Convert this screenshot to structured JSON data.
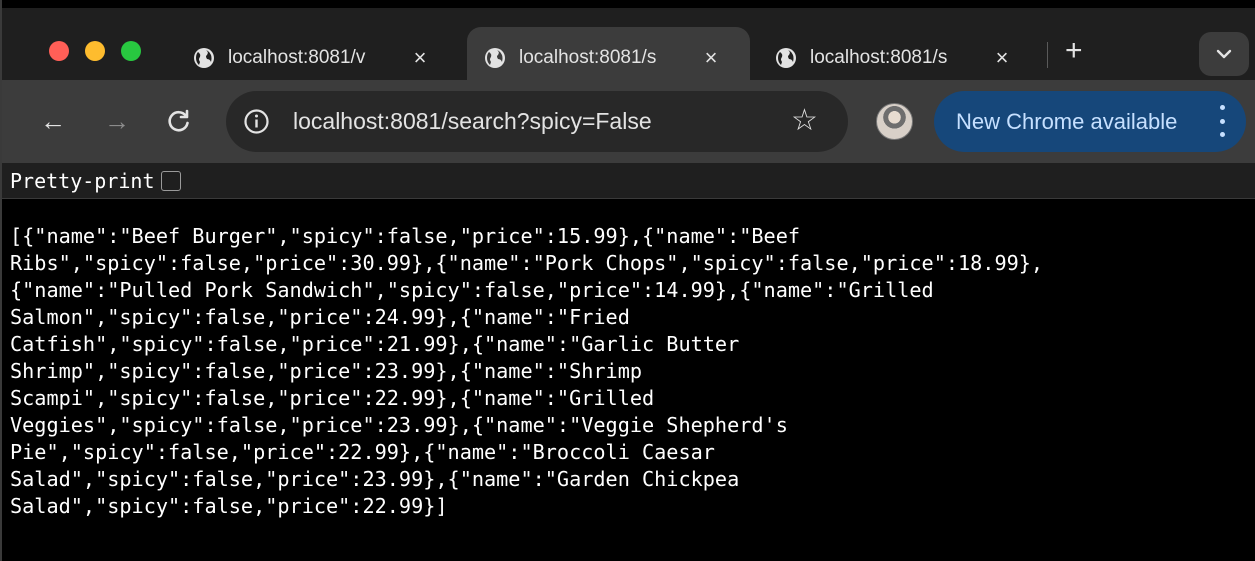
{
  "tabs": [
    {
      "title": "localhost:8081/v",
      "close": "×",
      "active": false
    },
    {
      "title": "localhost:8081/s",
      "close": "×",
      "active": true
    },
    {
      "title": "localhost:8081/s",
      "close": "×",
      "active": false
    }
  ],
  "new_tab_label": "+",
  "toolbar": {
    "back": "←",
    "forward": "→",
    "reload": "C",
    "url": "localhost:8081/search?spicy=False",
    "bookmark": "☆",
    "update_label": "New Chrome available"
  },
  "viewer": {
    "pretty_print_label": "Pretty-print",
    "pretty_print_checked": false
  },
  "json_lines": [
    "[{\"name\":\"Beef Burger\",\"spicy\":false,\"price\":15.99},{\"name\":\"Beef",
    "Ribs\",\"spicy\":false,\"price\":30.99},{\"name\":\"Pork Chops\",\"spicy\":false,\"price\":18.99},",
    "{\"name\":\"Pulled Pork Sandwich\",\"spicy\":false,\"price\":14.99},{\"name\":\"Grilled",
    "Salmon\",\"spicy\":false,\"price\":24.99},{\"name\":\"Fried",
    "Catfish\",\"spicy\":false,\"price\":21.99},{\"name\":\"Garlic Butter",
    "Shrimp\",\"spicy\":false,\"price\":23.99},{\"name\":\"Shrimp",
    "Scampi\",\"spicy\":false,\"price\":22.99},{\"name\":\"Grilled",
    "Veggies\",\"spicy\":false,\"price\":23.99},{\"name\":\"Veggie Shepherd's",
    "Pie\",\"spicy\":false,\"price\":22.99},{\"name\":\"Broccoli Caesar",
    "Salad\",\"spicy\":false,\"price\":23.99},{\"name\":\"Garden Chickpea",
    "Salad\",\"spicy\":false,\"price\":22.99}]"
  ],
  "icons": {
    "tab_favicon": "globe-icon",
    "site_info": "info-icon",
    "menu": "more-vert-icon",
    "tab_search": "chevron-down-icon"
  },
  "colors": {
    "close": "#ff5f57",
    "minimize": "#febc2e",
    "zoom": "#28c840",
    "update_button": "#16477a"
  }
}
